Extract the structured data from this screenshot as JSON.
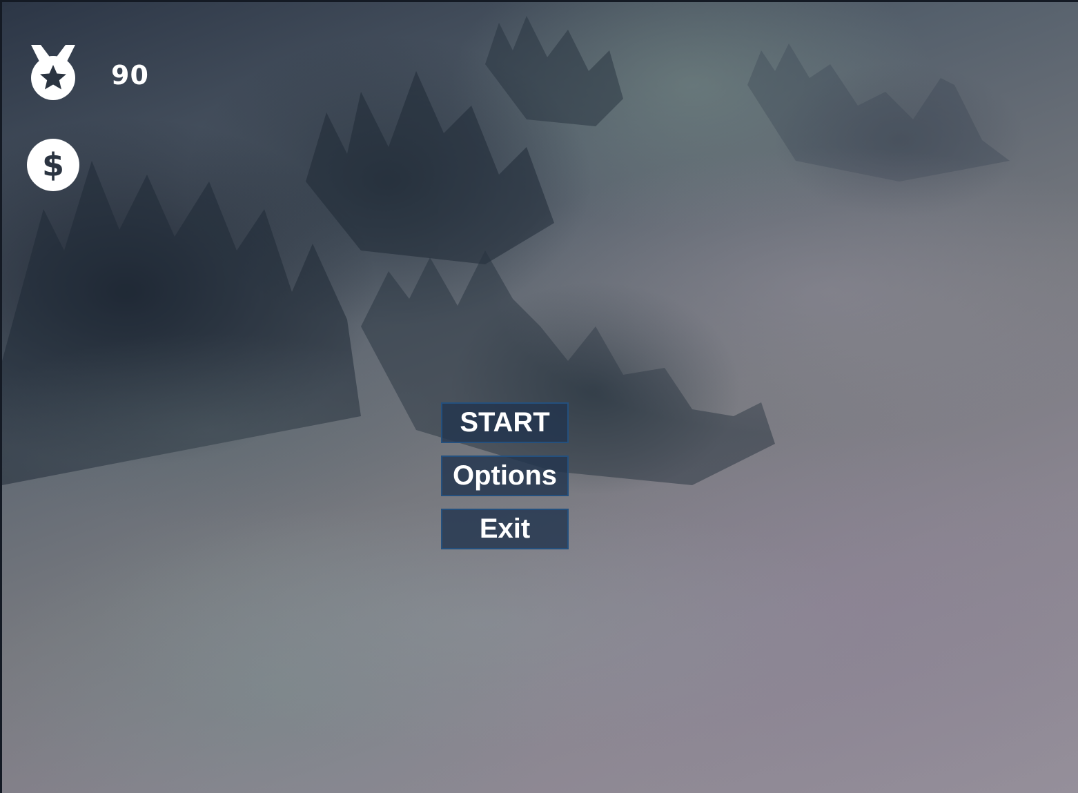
{
  "hud": {
    "medal_icon": "medal-star-icon",
    "score": "90",
    "money_icon": "dollar-coin-icon"
  },
  "menu": {
    "start_label": "START",
    "options_label": "Options",
    "exit_label": "Exit"
  },
  "colors": {
    "button_fill": "#22344e",
    "button_border": "#24507e",
    "text": "#ffffff"
  }
}
